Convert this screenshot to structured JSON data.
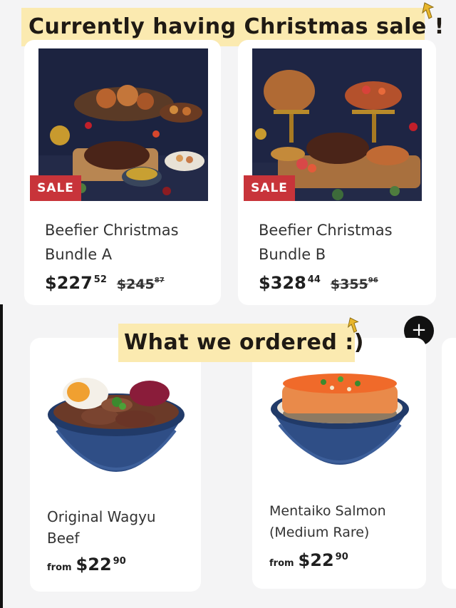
{
  "top_banner": {
    "text": "Currently having Christmas sale !"
  },
  "mid_banner": {
    "text": "What we ordered :)"
  },
  "sale_products": [
    {
      "badge": "SALE",
      "name_line1": "Beefier Christmas",
      "name_line2": "Bundle A",
      "price_whole": "$227",
      "price_cents": "52",
      "old_whole": "$245",
      "old_cents": "87"
    },
    {
      "badge": "SALE",
      "name_line1": "Beefier Christmas",
      "name_line2": "Bundle B",
      "price_whole": "$328",
      "price_cents": "44",
      "old_whole": "$355",
      "old_cents": "96"
    }
  ],
  "ordered_products": [
    {
      "name_line1": "Original Wagyu",
      "name_line2": "Beef",
      "from_label": "from",
      "price_whole": "$22",
      "price_cents": "90"
    },
    {
      "name_line1": "Mentaiko Salmon",
      "name_line2": "(Medium Rare)",
      "from_label": "from",
      "price_whole": "$22",
      "price_cents": "90"
    }
  ],
  "add_button": {
    "symbol": "+",
    "icon": "plus-icon"
  },
  "colors": {
    "banner": "#fbeab0",
    "sale_badge": "#c8343a",
    "bowl": "#2f4e86",
    "page_bg": "#f4f4f5"
  }
}
